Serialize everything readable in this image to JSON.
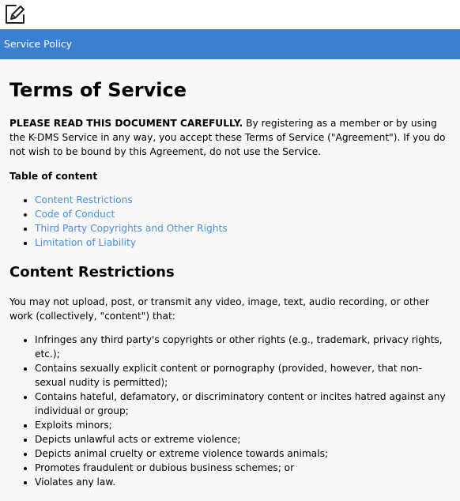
{
  "header": {
    "title": "Service Policy"
  },
  "document": {
    "title": "Terms of Service",
    "intro_bold": "PLEASE READ THIS DOCUMENT CAREFULLY.",
    "intro_text": " By registering as a member or by using the K-DMS Service in any way, you accept these Terms of Service (\"Agreement\"). If you do not wish to be bound by this Agreement, do not use the Service.",
    "toc_title": "Table of content",
    "toc": [
      "Content Restrictions",
      "Code of Conduct",
      "Third Party Copyrights and Other Rights",
      "Limitation of Liability"
    ],
    "section_title": "Content Restrictions",
    "section_lead": "You may not upload, post, or transmit any video, image, text, audio recording, or other work (collectively, \"content\") that:",
    "rules": [
      "Infringes any third party's copyrights or other rights (e.g., trademark, privacy rights, etc.);",
      "Contains sexually explicit content or pornography (provided, however, that non-sexual nudity is permitted);",
      "Contains hateful, defamatory, or discriminatory content or incites hatred against any individual or group;",
      "Exploits minors;",
      "Depicts unlawful acts or extreme violence;",
      "Depicts animal cruelty or extreme violence towards animals;",
      "Promotes fraudulent or dubious business schemes; or",
      "Violates any law."
    ]
  },
  "colors": {
    "header_bg": "#3b7fd0",
    "link": "#4a8fdb",
    "content_bg": "#f8f8f8"
  },
  "icons": {
    "logo": "pencil-edit-icon"
  }
}
